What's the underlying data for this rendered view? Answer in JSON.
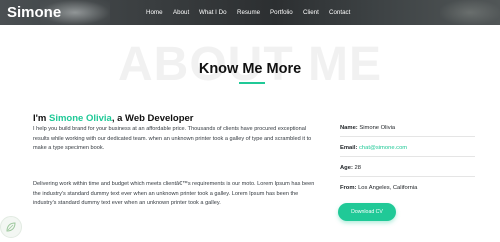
{
  "header": {
    "brand": "Simone",
    "nav": [
      "Home",
      "About",
      "What I Do",
      "Resume",
      "Portfolio",
      "Client",
      "Contact"
    ]
  },
  "about": {
    "background_title": "ABOUT ME",
    "title": "Know Me More",
    "intro_prefix": "I'm ",
    "intro_name": "Simone Olivia",
    "intro_suffix": ", a Web Developer",
    "paragraph1": "I help you build brand for your business at an affordable price. Thousands of clients have procured exceptional results while working with our dedicated team. when an unknown printer took a galley of type and scrambled it to make a type specimen book.",
    "paragraph2": "Delivering work within time and budget which meets clientâ€™s requirements is our moto. Lorem Ipsum has been the industry's standard dummy text ever when an unknown printer took a galley. Lorem Ipsum has been the industry's standard dummy text ever when an unknown printer took a galley.",
    "info": {
      "name_label": "Name:",
      "name_value": "Simone Olivia",
      "email_label": "Email:",
      "email_value": "chat@simone.com",
      "age_label": "Age:",
      "age_value": "28",
      "from_label": "From:",
      "from_value": "Los Angeles, California"
    },
    "download_label": "Download CV"
  },
  "colors": {
    "accent": "#20c997",
    "header_bg": "#3a3e40"
  },
  "icons": {
    "corner_badge": "leaf-icon"
  }
}
